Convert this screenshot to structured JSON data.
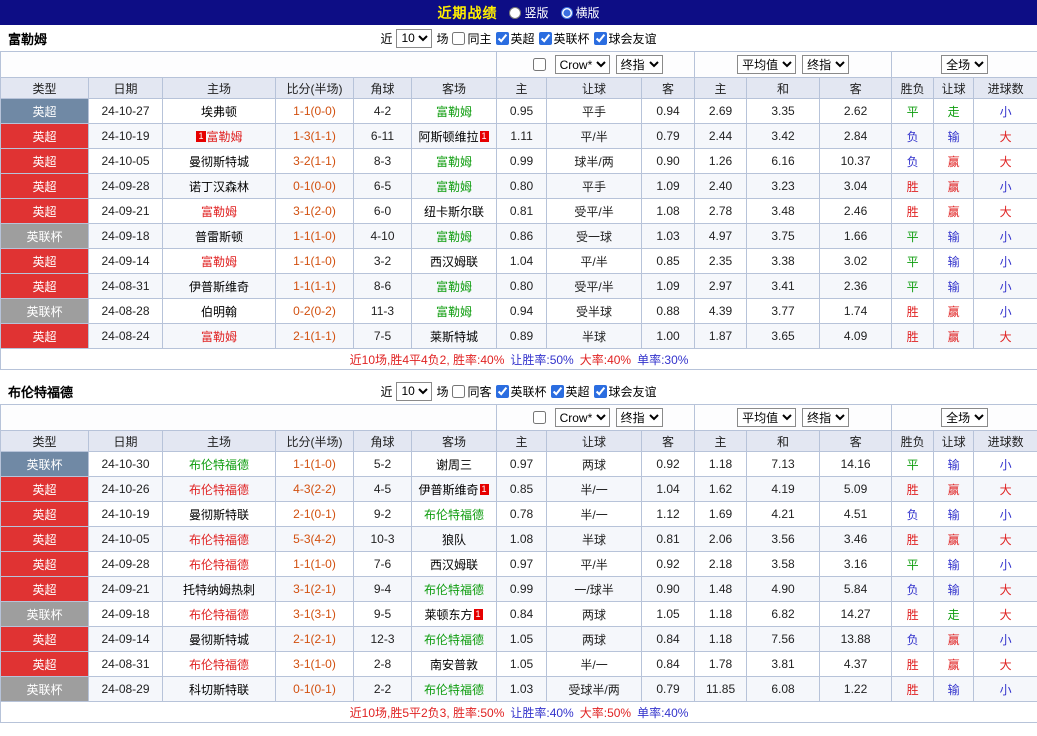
{
  "topbar": {
    "title": "近期战绩",
    "vertical_label": "竖版",
    "horizontal_label": "横版",
    "vertical_checked": false,
    "horizontal_checked": true
  },
  "controls": {
    "recent_prefix": "近",
    "recent_value": "10",
    "recent_suffix": "场",
    "bookmaker": "Crow*",
    "bookmaker_checkbox_checked": false,
    "final_index": "终指",
    "average": "平均值",
    "full_scope": "全场"
  },
  "table_columns": [
    "类型",
    "日期",
    "主场",
    "比分(半场)",
    "角球",
    "客场",
    "主",
    "让球",
    "客",
    "主",
    "和",
    "客",
    "胜负",
    "让球",
    "进球数"
  ],
  "sections": [
    {
      "team": "富勒姆",
      "filters": {
        "same": {
          "label": "同主",
          "checked": false
        },
        "leagues": [
          {
            "label": "英超",
            "checked": true
          },
          {
            "label": "英联杯",
            "checked": true
          },
          {
            "label": "球会友谊",
            "checked": true
          }
        ]
      },
      "rows": [
        {
          "league": "英超",
          "league_color": "blue",
          "date": "24-10-27",
          "home": {
            "name": "埃弗顿",
            "color": "black"
          },
          "score": "1-1(0-0)",
          "corners": "4-2",
          "away": {
            "name": "富勒姆",
            "color": "green"
          },
          "let_home": "0.95",
          "handicap": "平手",
          "let_away": "0.94",
          "avg_home": "2.69",
          "avg_draw": "3.35",
          "avg_away": "2.62",
          "result": {
            "text": "平",
            "color": "green"
          },
          "let_result": {
            "text": "走",
            "color": "green"
          },
          "goal_result": {
            "text": "小",
            "color": "blue"
          }
        },
        {
          "league": "英超",
          "league_color": "red",
          "date": "24-10-19",
          "home": {
            "name": "富勒姆",
            "color": "red",
            "badge_before": "1"
          },
          "score": "1-3(1-1)",
          "corners": "6-11",
          "away": {
            "name": "阿斯顿维拉",
            "color": "black",
            "badge_after": "1"
          },
          "let_home": "1.11",
          "handicap": "平/半",
          "let_away": "0.79",
          "avg_home": "2.44",
          "avg_draw": "3.42",
          "avg_away": "2.84",
          "result": {
            "text": "负",
            "color": "blue"
          },
          "let_result": {
            "text": "输",
            "color": "blue"
          },
          "goal_result": {
            "text": "大",
            "color": "red"
          }
        },
        {
          "league": "英超",
          "league_color": "red",
          "date": "24-10-05",
          "home": {
            "name": "曼彻斯特城",
            "color": "black"
          },
          "score": "3-2(1-1)",
          "corners": "8-3",
          "away": {
            "name": "富勒姆",
            "color": "green"
          },
          "let_home": "0.99",
          "handicap": "球半/两",
          "let_away": "0.90",
          "avg_home": "1.26",
          "avg_draw": "6.16",
          "avg_away": "10.37",
          "result": {
            "text": "负",
            "color": "blue"
          },
          "let_result": {
            "text": "赢",
            "color": "red"
          },
          "goal_result": {
            "text": "大",
            "color": "red"
          }
        },
        {
          "league": "英超",
          "league_color": "red",
          "date": "24-09-28",
          "home": {
            "name": "诺丁汉森林",
            "color": "black"
          },
          "score": "0-1(0-0)",
          "corners": "6-5",
          "away": {
            "name": "富勒姆",
            "color": "green"
          },
          "let_home": "0.80",
          "handicap": "平手",
          "let_away": "1.09",
          "avg_home": "2.40",
          "avg_draw": "3.23",
          "avg_away": "3.04",
          "result": {
            "text": "胜",
            "color": "red"
          },
          "let_result": {
            "text": "赢",
            "color": "red"
          },
          "goal_result": {
            "text": "小",
            "color": "blue"
          }
        },
        {
          "league": "英超",
          "league_color": "red",
          "date": "24-09-21",
          "home": {
            "name": "富勒姆",
            "color": "red"
          },
          "score": "3-1(2-0)",
          "corners": "6-0",
          "away": {
            "name": "纽卡斯尔联",
            "color": "black"
          },
          "let_home": "0.81",
          "handicap": "受平/半",
          "let_away": "1.08",
          "avg_home": "2.78",
          "avg_draw": "3.48",
          "avg_away": "2.46",
          "result": {
            "text": "胜",
            "color": "red"
          },
          "let_result": {
            "text": "赢",
            "color": "red"
          },
          "goal_result": {
            "text": "大",
            "color": "red"
          }
        },
        {
          "league": "英联杯",
          "league_color": "gray",
          "date": "24-09-18",
          "home": {
            "name": "普雷斯顿",
            "color": "black"
          },
          "score": "1-1(1-0)",
          "corners": "4-10",
          "away": {
            "name": "富勒姆",
            "color": "green"
          },
          "let_home": "0.86",
          "handicap": "受一球",
          "let_away": "1.03",
          "avg_home": "4.97",
          "avg_draw": "3.75",
          "avg_away": "1.66",
          "result": {
            "text": "平",
            "color": "green"
          },
          "let_result": {
            "text": "输",
            "color": "blue"
          },
          "goal_result": {
            "text": "小",
            "color": "blue"
          }
        },
        {
          "league": "英超",
          "league_color": "red",
          "date": "24-09-14",
          "home": {
            "name": "富勒姆",
            "color": "red"
          },
          "score": "1-1(1-0)",
          "corners": "3-2",
          "away": {
            "name": "西汉姆联",
            "color": "black"
          },
          "let_home": "1.04",
          "handicap": "平/半",
          "let_away": "0.85",
          "avg_home": "2.35",
          "avg_draw": "3.38",
          "avg_away": "3.02",
          "result": {
            "text": "平",
            "color": "green"
          },
          "let_result": {
            "text": "输",
            "color": "blue"
          },
          "goal_result": {
            "text": "小",
            "color": "blue"
          }
        },
        {
          "league": "英超",
          "league_color": "red",
          "date": "24-08-31",
          "home": {
            "name": "伊普斯维奇",
            "color": "black"
          },
          "score": "1-1(1-1)",
          "corners": "8-6",
          "away": {
            "name": "富勒姆",
            "color": "green"
          },
          "let_home": "0.80",
          "handicap": "受平/半",
          "let_away": "1.09",
          "avg_home": "2.97",
          "avg_draw": "3.41",
          "avg_away": "2.36",
          "result": {
            "text": "平",
            "color": "green"
          },
          "let_result": {
            "text": "输",
            "color": "blue"
          },
          "goal_result": {
            "text": "小",
            "color": "blue"
          }
        },
        {
          "league": "英联杯",
          "league_color": "gray",
          "date": "24-08-28",
          "home": {
            "name": "伯明翰",
            "color": "black"
          },
          "score": "0-2(0-2)",
          "corners": "11-3",
          "away": {
            "name": "富勒姆",
            "color": "green"
          },
          "let_home": "0.94",
          "handicap": "受半球",
          "let_away": "0.88",
          "avg_home": "4.39",
          "avg_draw": "3.77",
          "avg_away": "1.74",
          "result": {
            "text": "胜",
            "color": "red"
          },
          "let_result": {
            "text": "赢",
            "color": "red"
          },
          "goal_result": {
            "text": "小",
            "color": "blue"
          }
        },
        {
          "league": "英超",
          "league_color": "red",
          "date": "24-08-24",
          "home": {
            "name": "富勒姆",
            "color": "red"
          },
          "score": "2-1(1-1)",
          "corners": "7-5",
          "away": {
            "name": "莱斯特城",
            "color": "black"
          },
          "let_home": "0.89",
          "handicap": "半球",
          "let_away": "1.00",
          "avg_home": "1.87",
          "avg_draw": "3.65",
          "avg_away": "4.09",
          "result": {
            "text": "胜",
            "color": "red"
          },
          "let_result": {
            "text": "赢",
            "color": "red"
          },
          "goal_result": {
            "text": "大",
            "color": "red"
          }
        }
      ],
      "summary": [
        {
          "text": "近10场,胜4平4负2, 胜率:40%",
          "color": "red"
        },
        {
          "text": "让胜率:50%",
          "color": "blue"
        },
        {
          "text": "大率:40%",
          "color": "red"
        },
        {
          "text": "单率:30%",
          "color": "blue"
        }
      ]
    },
    {
      "team": "布伦特福德",
      "filters": {
        "same": {
          "label": "同客",
          "checked": false
        },
        "leagues": [
          {
            "label": "英联杯",
            "checked": true
          },
          {
            "label": "英超",
            "checked": true
          },
          {
            "label": "球会友谊",
            "checked": true
          }
        ]
      },
      "rows": [
        {
          "league": "英联杯",
          "league_color": "blue",
          "date": "24-10-30",
          "home": {
            "name": "布伦特福德",
            "color": "green"
          },
          "score": "1-1(1-0)",
          "corners": "5-2",
          "away": {
            "name": "谢周三",
            "color": "black"
          },
          "let_home": "0.97",
          "handicap": "两球",
          "let_away": "0.92",
          "avg_home": "1.18",
          "avg_draw": "7.13",
          "avg_away": "14.16",
          "result": {
            "text": "平",
            "color": "green"
          },
          "let_result": {
            "text": "输",
            "color": "blue"
          },
          "goal_result": {
            "text": "小",
            "color": "blue"
          }
        },
        {
          "league": "英超",
          "league_color": "red",
          "date": "24-10-26",
          "home": {
            "name": "布伦特福德",
            "color": "red"
          },
          "score": "4-3(2-2)",
          "corners": "4-5",
          "away": {
            "name": "伊普斯维奇",
            "color": "black",
            "badge_after": "1"
          },
          "let_home": "0.85",
          "handicap": "半/一",
          "let_away": "1.04",
          "avg_home": "1.62",
          "avg_draw": "4.19",
          "avg_away": "5.09",
          "result": {
            "text": "胜",
            "color": "red"
          },
          "let_result": {
            "text": "赢",
            "color": "red"
          },
          "goal_result": {
            "text": "大",
            "color": "red"
          }
        },
        {
          "league": "英超",
          "league_color": "red",
          "date": "24-10-19",
          "home": {
            "name": "曼彻斯特联",
            "color": "black"
          },
          "score": "2-1(0-1)",
          "corners": "9-2",
          "away": {
            "name": "布伦特福德",
            "color": "green"
          },
          "let_home": "0.78",
          "handicap": "半/一",
          "let_away": "1.12",
          "avg_home": "1.69",
          "avg_draw": "4.21",
          "avg_away": "4.51",
          "result": {
            "text": "负",
            "color": "blue"
          },
          "let_result": {
            "text": "输",
            "color": "blue"
          },
          "goal_result": {
            "text": "小",
            "color": "blue"
          }
        },
        {
          "league": "英超",
          "league_color": "red",
          "date": "24-10-05",
          "home": {
            "name": "布伦特福德",
            "color": "red"
          },
          "score": "5-3(4-2)",
          "corners": "10-3",
          "away": {
            "name": "狼队",
            "color": "black"
          },
          "let_home": "1.08",
          "handicap": "半球",
          "let_away": "0.81",
          "avg_home": "2.06",
          "avg_draw": "3.56",
          "avg_away": "3.46",
          "result": {
            "text": "胜",
            "color": "red"
          },
          "let_result": {
            "text": "赢",
            "color": "red"
          },
          "goal_result": {
            "text": "大",
            "color": "red"
          }
        },
        {
          "league": "英超",
          "league_color": "red",
          "date": "24-09-28",
          "home": {
            "name": "布伦特福德",
            "color": "red"
          },
          "score": "1-1(1-0)",
          "corners": "7-6",
          "away": {
            "name": "西汉姆联",
            "color": "black"
          },
          "let_home": "0.97",
          "handicap": "平/半",
          "let_away": "0.92",
          "avg_home": "2.18",
          "avg_draw": "3.58",
          "avg_away": "3.16",
          "result": {
            "text": "平",
            "color": "green"
          },
          "let_result": {
            "text": "输",
            "color": "blue"
          },
          "goal_result": {
            "text": "小",
            "color": "blue"
          }
        },
        {
          "league": "英超",
          "league_color": "red",
          "date": "24-09-21",
          "home": {
            "name": "托特纳姆热刺",
            "color": "black"
          },
          "score": "3-1(2-1)",
          "corners": "9-4",
          "away": {
            "name": "布伦特福德",
            "color": "green"
          },
          "let_home": "0.99",
          "handicap": "一/球半",
          "let_away": "0.90",
          "avg_home": "1.48",
          "avg_draw": "4.90",
          "avg_away": "5.84",
          "result": {
            "text": "负",
            "color": "blue"
          },
          "let_result": {
            "text": "输",
            "color": "blue"
          },
          "goal_result": {
            "text": "大",
            "color": "red"
          }
        },
        {
          "league": "英联杯",
          "league_color": "gray",
          "date": "24-09-18",
          "home": {
            "name": "布伦特福德",
            "color": "red"
          },
          "score": "3-1(3-1)",
          "corners": "9-5",
          "away": {
            "name": "莱顿东方",
            "color": "black",
            "badge_after": "1"
          },
          "let_home": "0.84",
          "handicap": "两球",
          "let_away": "1.05",
          "avg_home": "1.18",
          "avg_draw": "6.82",
          "avg_away": "14.27",
          "result": {
            "text": "胜",
            "color": "red"
          },
          "let_result": {
            "text": "走",
            "color": "green"
          },
          "goal_result": {
            "text": "大",
            "color": "red"
          }
        },
        {
          "league": "英超",
          "league_color": "red",
          "date": "24-09-14",
          "home": {
            "name": "曼彻斯特城",
            "color": "black"
          },
          "score": "2-1(2-1)",
          "corners": "12-3",
          "away": {
            "name": "布伦特福德",
            "color": "green"
          },
          "let_home": "1.05",
          "handicap": "两球",
          "let_away": "0.84",
          "avg_home": "1.18",
          "avg_draw": "7.56",
          "avg_away": "13.88",
          "result": {
            "text": "负",
            "color": "blue"
          },
          "let_result": {
            "text": "赢",
            "color": "red"
          },
          "goal_result": {
            "text": "小",
            "color": "blue"
          }
        },
        {
          "league": "英超",
          "league_color": "red",
          "date": "24-08-31",
          "home": {
            "name": "布伦特福德",
            "color": "red"
          },
          "score": "3-1(1-0)",
          "corners": "2-8",
          "away": {
            "name": "南安普敦",
            "color": "black"
          },
          "let_home": "1.05",
          "handicap": "半/一",
          "let_away": "0.84",
          "avg_home": "1.78",
          "avg_draw": "3.81",
          "avg_away": "4.37",
          "result": {
            "text": "胜",
            "color": "red"
          },
          "let_result": {
            "text": "赢",
            "color": "red"
          },
          "goal_result": {
            "text": "大",
            "color": "red"
          }
        },
        {
          "league": "英联杯",
          "league_color": "gray",
          "date": "24-08-29",
          "home": {
            "name": "科切斯特联",
            "color": "black"
          },
          "score": "0-1(0-1)",
          "corners": "2-2",
          "away": {
            "name": "布伦特福德",
            "color": "green"
          },
          "let_home": "1.03",
          "handicap": "受球半/两",
          "let_away": "0.79",
          "avg_home": "11.85",
          "avg_draw": "6.08",
          "avg_away": "1.22",
          "result": {
            "text": "胜",
            "color": "red"
          },
          "let_result": {
            "text": "输",
            "color": "blue"
          },
          "goal_result": {
            "text": "小",
            "color": "blue"
          }
        }
      ],
      "summary": [
        {
          "text": "近10场,胜5平2负3, 胜率:50%",
          "color": "red"
        },
        {
          "text": "让胜率:40%",
          "color": "blue"
        },
        {
          "text": "大率:50%",
          "color": "red"
        },
        {
          "text": "单率:40%",
          "color": "blue"
        }
      ]
    }
  ]
}
